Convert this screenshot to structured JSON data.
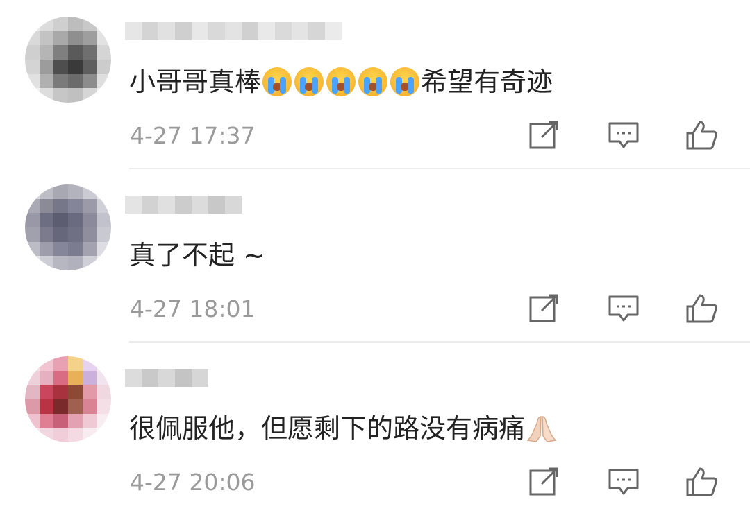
{
  "comments": [
    {
      "text_main": "小哥哥真棒",
      "emoji_count": 5,
      "emoji_name": "loudly-crying-face-icon",
      "text_tail": "希望有奇迹",
      "time": "4-27 17:37"
    },
    {
      "text_main": "真了不起 ~",
      "time": "4-27 18:01"
    },
    {
      "text_main": "很佩服他，但愿剩下的路没有病痛",
      "emoji_name": "folded-hands-icon",
      "time": "4-27 20:06"
    }
  ],
  "icons": {
    "share": "share-icon",
    "comment": "comment-icon",
    "like": "thumbs-up-icon"
  },
  "colors": {
    "text": "#222222",
    "meta": "#9a9a9a",
    "icon": "#666666",
    "divider": "#ececec"
  }
}
